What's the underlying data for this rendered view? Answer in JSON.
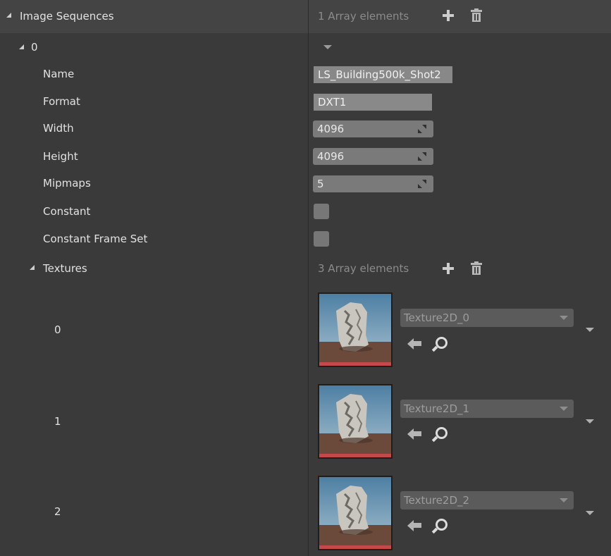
{
  "details": {
    "image_sequences": {
      "label": "Image Sequences",
      "count_text": "1 Array elements",
      "element": {
        "index": "0",
        "name": {
          "label": "Name",
          "value": "LS_Building500k_Shot2"
        },
        "format": {
          "label": "Format",
          "value": "DXT1"
        },
        "width": {
          "label": "Width",
          "value": "4096"
        },
        "height": {
          "label": "Height",
          "value": "4096"
        },
        "mipmaps": {
          "label": "Mipmaps",
          "value": "5"
        },
        "constant": {
          "label": "Constant",
          "checked": false
        },
        "constant_frame_set": {
          "label": "Constant Frame Set",
          "checked": false
        },
        "textures": {
          "label": "Textures",
          "count_text": "3 Array elements",
          "items": [
            {
              "index": "0",
              "asset": "Texture2D_0"
            },
            {
              "index": "1",
              "asset": "Texture2D_1"
            },
            {
              "index": "2",
              "asset": "Texture2D_2"
            }
          ]
        }
      }
    }
  },
  "icons": {
    "expand": "triangle-expanded-icon",
    "add": "plus-icon",
    "delete": "trash-icon",
    "dropdown": "chevron-down-icon",
    "use_selected": "arrow-left-icon",
    "browse": "search-icon",
    "spin": "resize-arrows-icon"
  },
  "colors": {
    "panel_bg": "#3a3a3a",
    "category_bg": "#444444",
    "thumbnail_bar": "#c44a4a"
  }
}
